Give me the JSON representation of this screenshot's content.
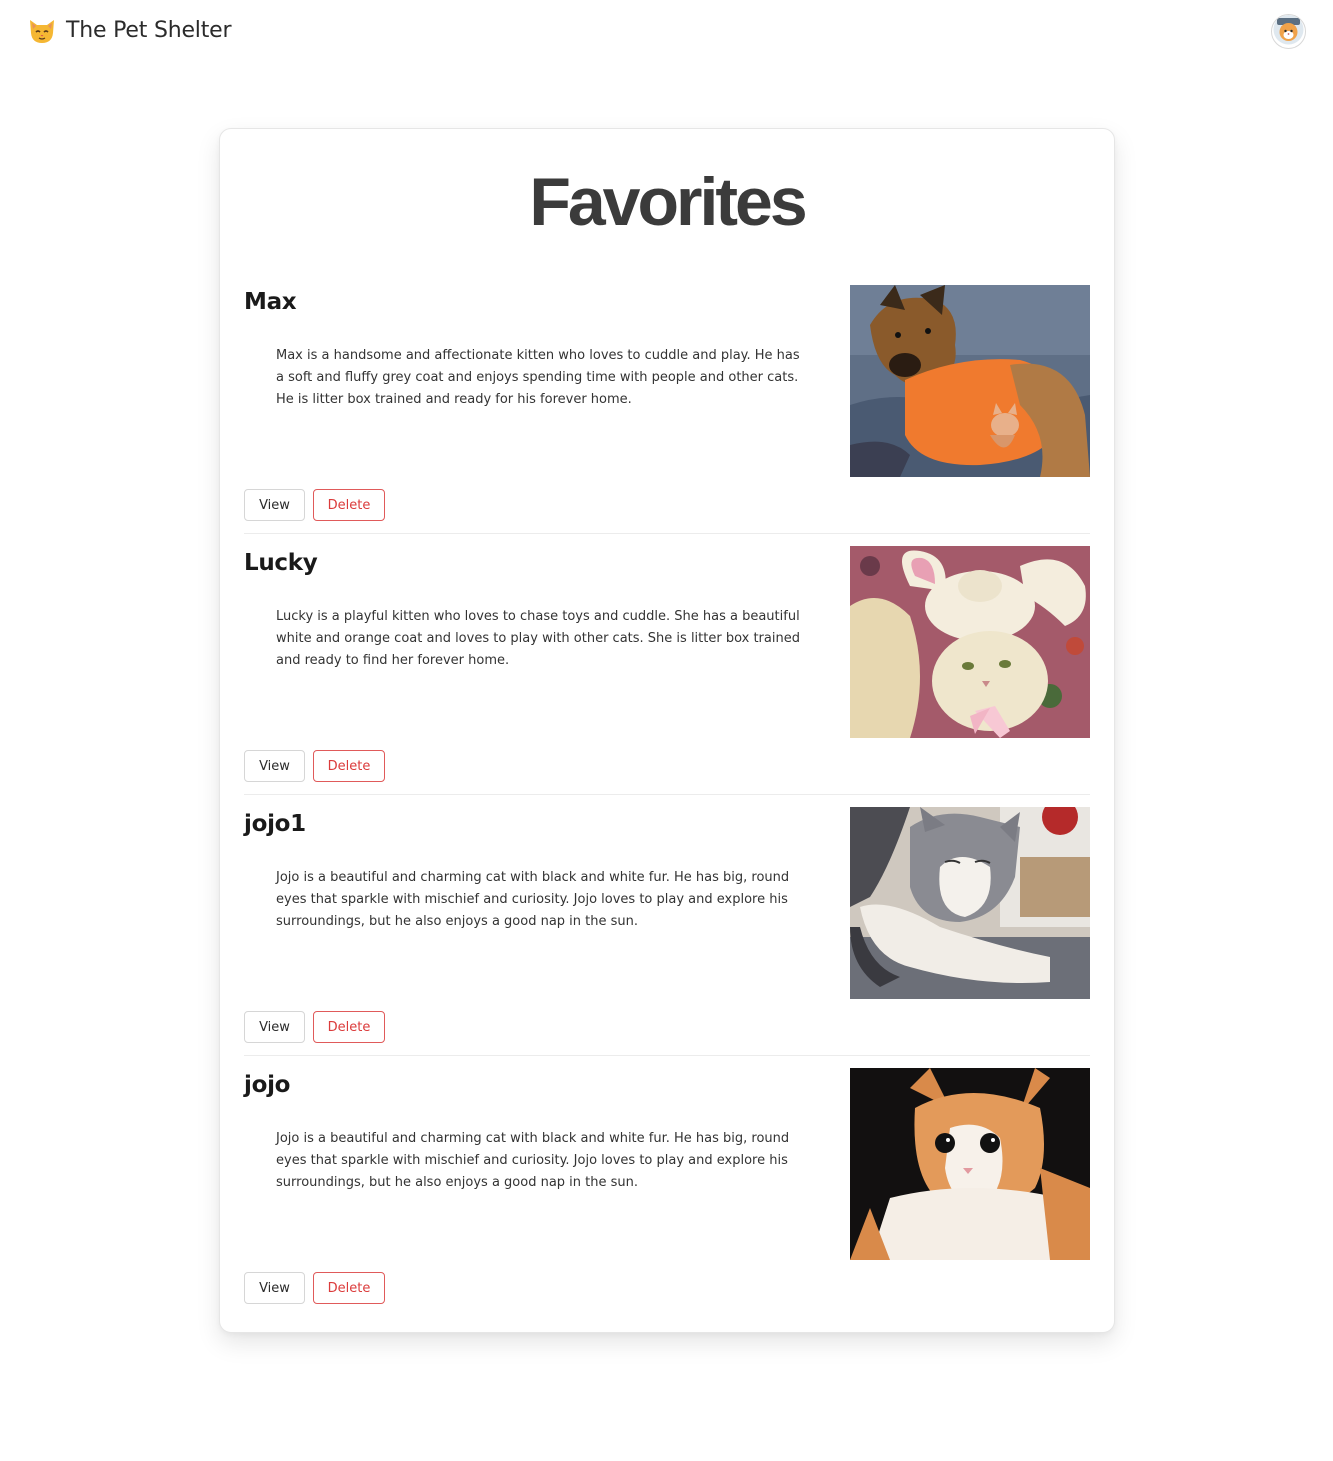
{
  "app": {
    "title": "The Pet Shelter",
    "logo_icon": "cat-face-icon",
    "avatar_icon": "user-avatar-icon"
  },
  "page": {
    "title": "Favorites"
  },
  "pets": [
    {
      "name": "Max",
      "description": "Max is a handsome and affectionate kitten who loves to cuddle and play. He has a soft and fluffy grey coat and enjoys spending time with people and other cats. He is litter box trained and ready for his forever home.",
      "photo_icon": "dog-with-kitten-photo",
      "view_label": "View",
      "delete_label": "Delete"
    },
    {
      "name": "Lucky",
      "description": "Lucky is a playful kitten who loves to chase toys and cuddle. She has a beautiful white and orange coat and loves to play with other cats. She is litter box trained and ready to find her forever home.",
      "photo_icon": "cat-in-bunny-hat-photo",
      "view_label": "View",
      "delete_label": "Delete"
    },
    {
      "name": "jojo1",
      "description": "Jojo is a beautiful and charming cat with black and white fur. He has big, round eyes that sparkle with mischief and curiosity. Jojo loves to play and explore his surroundings, but he also enjoys a good nap in the sun.",
      "photo_icon": "sleeping-grey-cat-photo",
      "view_label": "View",
      "delete_label": "Delete"
    },
    {
      "name": "jojo",
      "description": "Jojo is a beautiful and charming cat with black and white fur. He has big, round eyes that sparkle with mischief and curiosity. Jojo loves to play and explore his surroundings, but he also enjoys a good nap in the sun.",
      "photo_icon": "orange-white-cat-photo",
      "view_label": "View",
      "delete_label": "Delete"
    }
  ],
  "colors": {
    "delete_accent": "#db3b3b",
    "title_text": "#3b3b3b",
    "card_border": "#e6e6e6"
  }
}
